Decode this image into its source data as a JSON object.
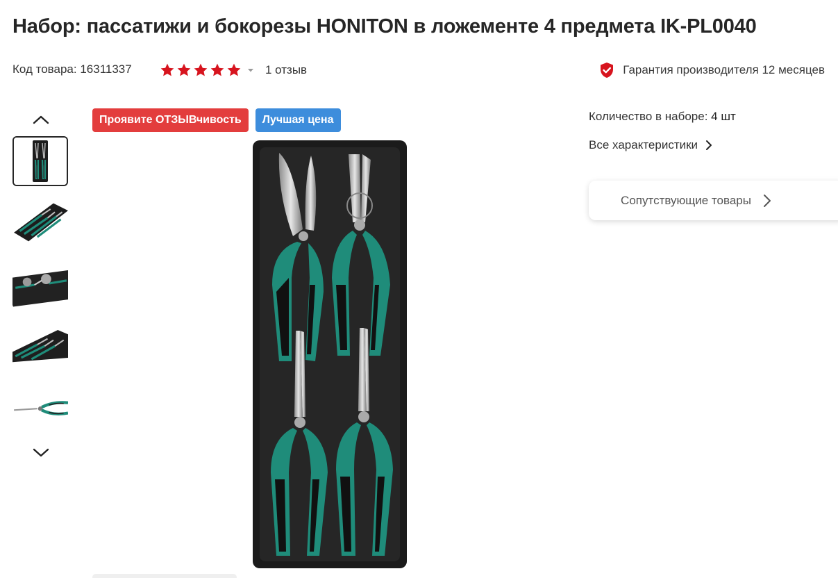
{
  "product": {
    "title": "Набор: пассатижи и бокорезы HONITON в ложементе 4 предмета IK-PL0040",
    "sku_label": "Код товара: 16311337",
    "rating": 5,
    "rating_max": 5,
    "reviews_label": "1 отзыв",
    "warranty_label": "Гарантия производителя 12 месяцев"
  },
  "badges": [
    {
      "label": "Проявите ОТЗЫВчивость",
      "color": "#e33d3d"
    },
    {
      "label": "Лучшая цена",
      "color": "#3d8ddc"
    }
  ],
  "gallery": {
    "thumbnails": [
      "tray-top-view",
      "tray-angled-view",
      "tray-closeup",
      "tray-side-view",
      "needle-nose-pliers"
    ],
    "active_index": 0,
    "up_icon": "chevron-up-icon",
    "down_icon": "chevron-down-icon"
  },
  "specs": {
    "quantity_label": "Количество в наборе:",
    "quantity_value": "4 шт",
    "all_specs_label": "Все характеристики"
  },
  "related": {
    "label": "Сопутствующие товары"
  },
  "colors": {
    "accent_red": "#e33d3d",
    "accent_blue": "#3d8ddc",
    "star": "#d7141e",
    "handle_teal": "#1f8c7a"
  }
}
